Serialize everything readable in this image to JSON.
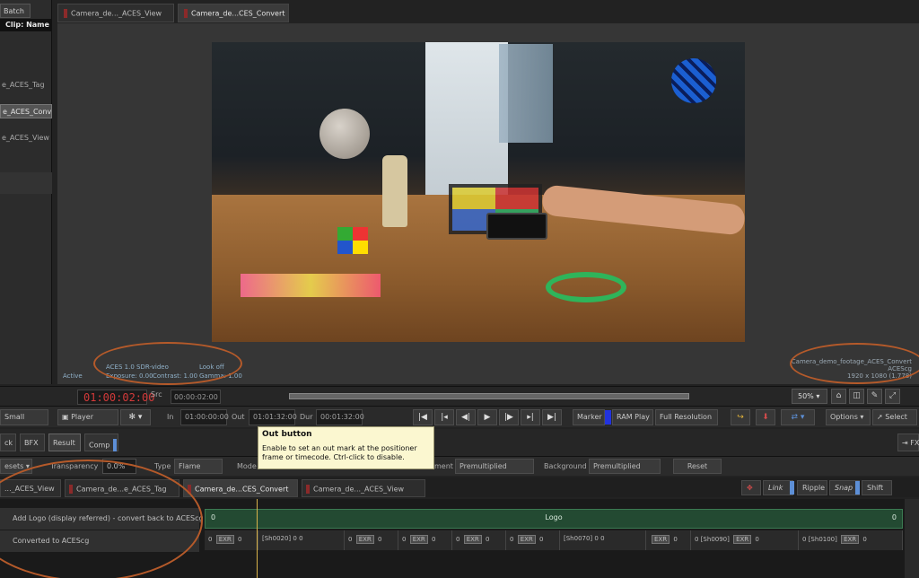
{
  "left_panel": {
    "tab": "Batch",
    "clip_header": "Clip: Name",
    "items": [
      {
        "label": "e_ACES_Tag",
        "selected": false
      },
      {
        "label": "e_ACES_Conve",
        "selected": true
      },
      {
        "label": "e_ACES_View",
        "selected": false
      }
    ]
  },
  "viewer": {
    "tabs": [
      {
        "label": "Camera_de..._ACES_View",
        "active": false
      },
      {
        "label": "Camera_de...CES_Convert",
        "active": true
      }
    ],
    "overlay": {
      "active": "Active",
      "lut": "ACES 1.0 SDR-video",
      "look": "Look off",
      "exposure": "Exposure: 0.00",
      "contrast": "Contrast: 1.00",
      "gamma": "Gamma: 1.00",
      "clip_name": "Camera_demo_footage_ACES_Convert",
      "colorspace": "ACEScg",
      "resolution": "1920 x 1080 (1.778)"
    }
  },
  "timecode_bar": {
    "current_tc": "01:00:02:00",
    "src_label": "Src",
    "src_tc": "00:00:02:00",
    "zoom": "50%"
  },
  "transport": {
    "size_label": "Small",
    "player_label": "Player",
    "in_label": "In",
    "in_tc": "01:00:00:00",
    "out_label": "Out",
    "out_tc": "01:01:32:00",
    "dur_label": "Dur",
    "dur_tc": "00:01:32:00",
    "marker_label": "Marker",
    "ramplay_label": "RAM Play",
    "resolution_label": "Full Resolution",
    "options_label": "Options",
    "select_label": "Select"
  },
  "tooltip": {
    "title": "Out button",
    "body": "Enable to set an out mark at the positioner frame or timecode. Ctrl-click to disable."
  },
  "batch_row": {
    "back_label": "ck",
    "bfx_label": "BFX",
    "result_label": "Result",
    "comp_label": "Comp",
    "fx_label": "FX"
  },
  "props_row": {
    "presets_label": "esets",
    "transparency_label": "Transparency",
    "transparency_value": "0.0%",
    "type_label": "Type",
    "type_value": "Flame",
    "mode_label": "Mode",
    "alignment_label": "ment",
    "alignment_value": "Premultiplied",
    "background_label": "Background",
    "background_value": "Premultiplied",
    "reset_label": "Reset"
  },
  "timeline_tabs": [
    {
      "label": "..._ACES_View",
      "active": false
    },
    {
      "label": "Camera_de...e_ACES_Tag",
      "active": false
    },
    {
      "label": "Camera_de...CES_Convert",
      "active": true
    },
    {
      "label": "Camera_de..._ACES_View",
      "active": false
    }
  ],
  "timeline_tools": {
    "link": "Link",
    "ripple": "Ripple",
    "snap": "Snap",
    "shift": "Shift"
  },
  "tracks": {
    "track1_name": "Add Logo (display referred) - convert back to ACEScg",
    "track2_name": "Converted to ACEScg",
    "logo_clip": "Logo",
    "zero": "0",
    "exr": "EXR",
    "shots": [
      "[Sh0020]",
      "[Sh0070]",
      "[Sh0090]",
      "[Sh0100]"
    ]
  },
  "colors": {
    "tc_red": "#d43a3a",
    "accent_blue": "#5d8fd6",
    "annotation_orange": "#b55a2a",
    "logo_track_green": "#234a32",
    "tooltip_bg": "#fbf7d0"
  }
}
